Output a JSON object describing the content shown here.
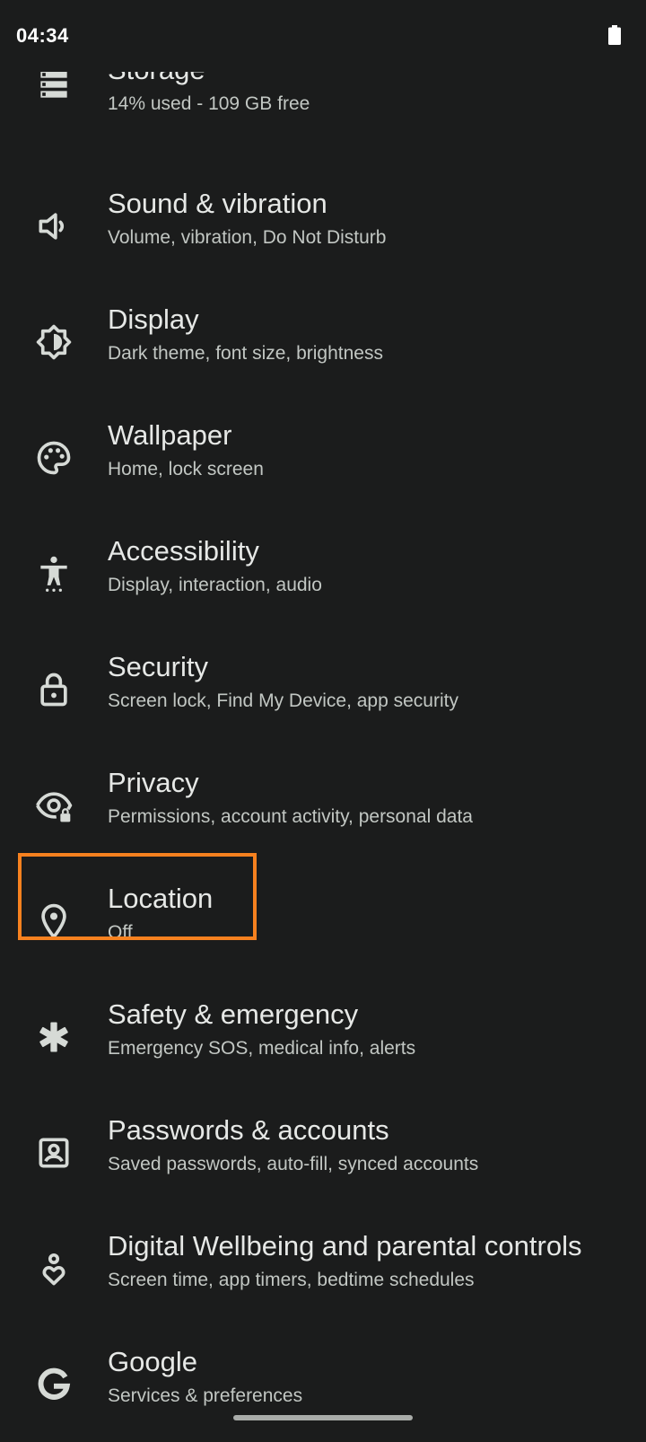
{
  "status_bar": {
    "time": "04:34",
    "battery_icon": "battery-full-icon"
  },
  "settings": [
    {
      "id": "storage",
      "icon": "storage-icon",
      "title": "Storage",
      "subtitle": "14% used - 109 GB free"
    },
    {
      "id": "sound",
      "icon": "speaker-icon",
      "title": "Sound & vibration",
      "subtitle": "Volume, vibration, Do Not Disturb"
    },
    {
      "id": "display",
      "icon": "brightness-icon",
      "title": "Display",
      "subtitle": "Dark theme, font size, brightness"
    },
    {
      "id": "wallpaper",
      "icon": "palette-icon",
      "title": "Wallpaper",
      "subtitle": "Home, lock screen"
    },
    {
      "id": "accessibility",
      "icon": "accessibility-icon",
      "title": "Accessibility",
      "subtitle": "Display, interaction, audio"
    },
    {
      "id": "security",
      "icon": "lock-icon",
      "title": "Security",
      "subtitle": "Screen lock, Find My Device, app security"
    },
    {
      "id": "privacy",
      "icon": "eye-lock-icon",
      "title": "Privacy",
      "subtitle": "Permissions, account activity, personal data"
    },
    {
      "id": "location",
      "icon": "location-pin-icon",
      "title": "Location",
      "subtitle": "Off",
      "highlighted": true
    },
    {
      "id": "safety",
      "icon": "asterisk-icon",
      "title": "Safety & emergency",
      "subtitle": "Emergency SOS, medical info, alerts"
    },
    {
      "id": "passwords",
      "icon": "account-box-icon",
      "title": "Passwords & accounts",
      "subtitle": "Saved passwords, auto-fill, synced accounts"
    },
    {
      "id": "wellbeing",
      "icon": "wellbeing-heart-icon",
      "title": "Digital Wellbeing and parental controls",
      "subtitle": "Screen time, app timers, bedtime schedules"
    },
    {
      "id": "google",
      "icon": "google-g-icon",
      "title": "Google",
      "subtitle": "Services & preferences"
    }
  ],
  "colors": {
    "background": "#1b1c1c",
    "highlight": "#f7811f",
    "text_primary": "#e6e8e6",
    "text_secondary": "#c2c7c3"
  }
}
